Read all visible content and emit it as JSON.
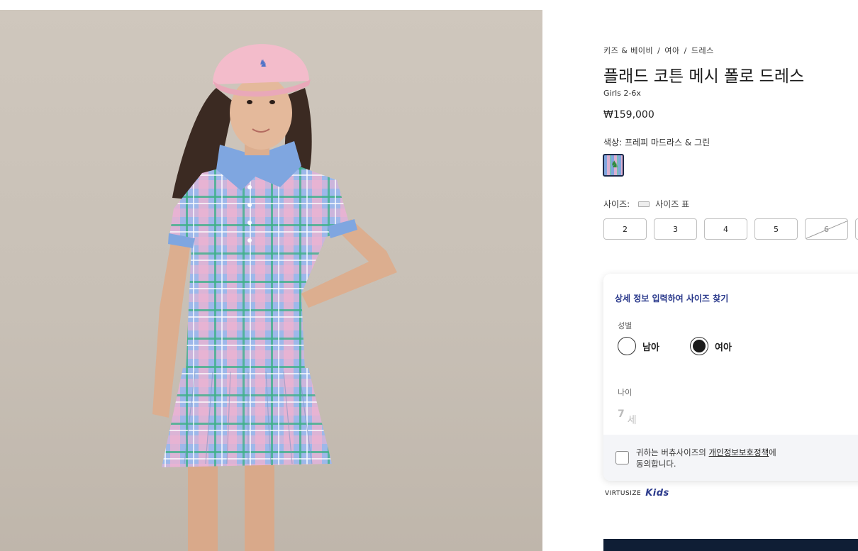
{
  "product": {
    "breadcrumb": [
      "키즈 & 베이비",
      "여아",
      "드레스"
    ],
    "title": "플래드 코튼 메시 폴로 드레스",
    "subtitle": "Girls 2-6x",
    "price": "₩159,000"
  },
  "color": {
    "label": "색상:",
    "value": "프레피 마드라스 & 그린"
  },
  "size": {
    "label": "사이즈:",
    "chart_label": "사이즈 표",
    "options": [
      {
        "label": "2",
        "available": true
      },
      {
        "label": "3",
        "available": true
      },
      {
        "label": "4",
        "available": true
      },
      {
        "label": "5",
        "available": true
      },
      {
        "label": "6",
        "available": false
      }
    ]
  },
  "virtusize": {
    "heading": "상세 정보 입력하여 사이즈 찾기",
    "gender_label": "성별",
    "gender_options": [
      "남아",
      "여아"
    ],
    "gender_selected": "여아",
    "age_label": "나이",
    "age_value": "7",
    "age_unit": "세",
    "consent_prefix": "귀하는 버츄사이즈의 ",
    "consent_link": "개인정보보호정책",
    "consent_suffix": "에 동의합니다.",
    "brand": "VIRTUSIZE",
    "brand_kids": "Kids"
  },
  "colors": {
    "accent_navy": "#0f1e35",
    "virtusize_blue": "#2b3a8c"
  }
}
